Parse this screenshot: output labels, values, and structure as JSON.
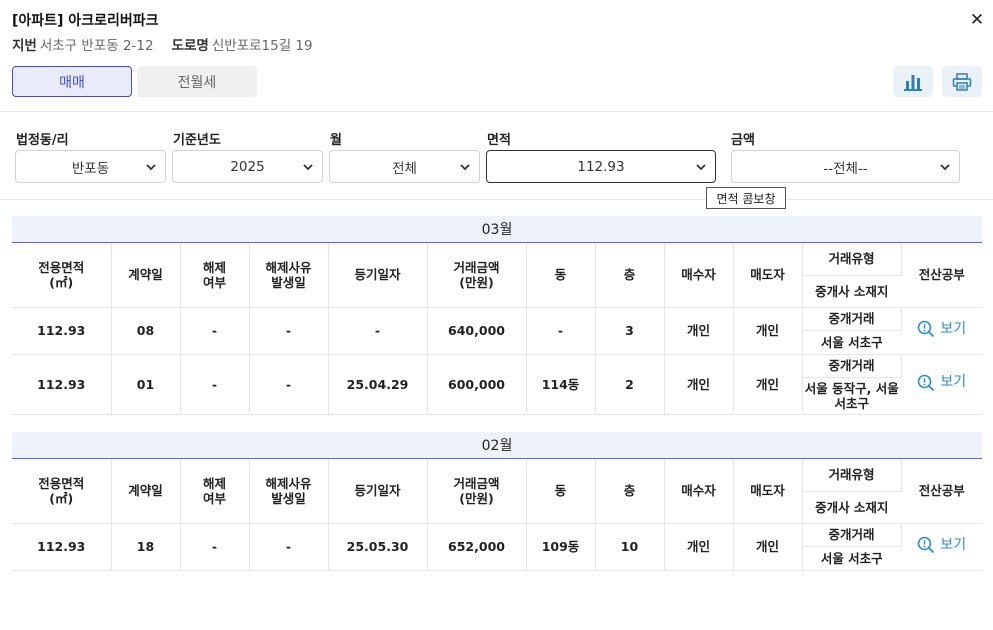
{
  "header": {
    "title": "[아파트] 아크로리버파크",
    "jibun_label": "지번",
    "jibun_value": "서초구 반포동 2-12",
    "road_label": "도로명",
    "road_value": "신반포로15길 19"
  },
  "tabs": {
    "sale": "매매",
    "rent": "전월세"
  },
  "filters": {
    "region_label": "법정동/리",
    "region_value": "반포동",
    "year_label": "기준년도",
    "year_value": "2025",
    "month_label": "월",
    "month_value": "전체",
    "area_label": "면적",
    "area_value": "112.93",
    "price_label": "금액",
    "price_value": "--전체--",
    "tooltip": "면적 콤보창"
  },
  "columns": {
    "area": "전용면적\n(㎡)",
    "contract_day": "계약일",
    "cancel": "해제\n여부",
    "cancel_reason": "해제사유\n발생일",
    "reg_date": "등기일자",
    "price": "거래금액\n(만원)",
    "dong": "동",
    "floor": "층",
    "buyer": "매수자",
    "seller": "매도자",
    "trade_type": "거래유형",
    "broker": "중개사 소재지",
    "doc": "전산공부"
  },
  "view_label": "보기",
  "sections": [
    {
      "month": "03월",
      "rows": [
        {
          "area": "112.93",
          "day": "08",
          "cancel": "-",
          "reason": "-",
          "reg": "-",
          "price": "640,000",
          "dong": "-",
          "floor": "3",
          "buyer": "개인",
          "seller": "개인",
          "type": "중개거래",
          "broker": "서울 서초구"
        },
        {
          "area": "112.93",
          "day": "01",
          "cancel": "-",
          "reason": "-",
          "reg": "25.04.29",
          "price": "600,000",
          "dong": "114동",
          "floor": "2",
          "buyer": "개인",
          "seller": "개인",
          "type": "중개거래",
          "broker": "서울 동작구, 서울\n서초구"
        }
      ]
    },
    {
      "month": "02월",
      "rows": [
        {
          "area": "112.93",
          "day": "18",
          "cancel": "-",
          "reason": "-",
          "reg": "25.05.30",
          "price": "652,000",
          "dong": "109동",
          "floor": "10",
          "buyer": "개인",
          "seller": "개인",
          "type": "중개거래",
          "broker": "서울 서초구"
        }
      ]
    }
  ],
  "colors": {
    "accent": "#3f4ec6",
    "link": "#2e8fc4"
  }
}
